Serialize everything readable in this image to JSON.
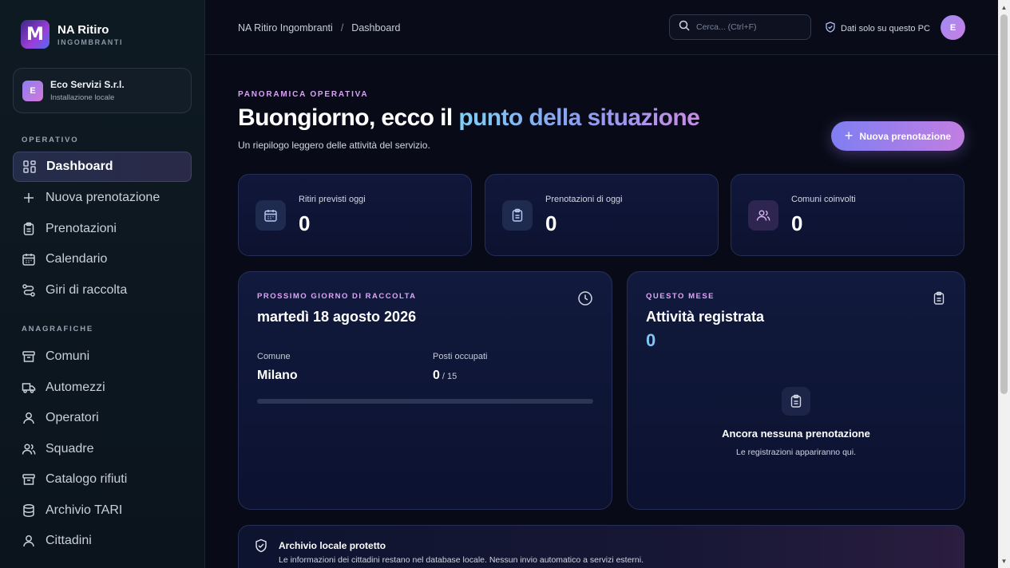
{
  "brand": {
    "name": "NA Ritiro",
    "subtitle": "INGOMBRANTI"
  },
  "org": {
    "avatar": "E",
    "name": "Eco Servizi S.r.l.",
    "subtitle": "Installazione locale"
  },
  "sidebar": {
    "section_operativo": "OPERATIVO",
    "section_anagrafiche": "ANAGRAFICHE",
    "operativo": [
      {
        "label": "Dashboard",
        "icon": "dashboard-icon",
        "active": true
      },
      {
        "label": "Nuova prenotazione",
        "icon": "plus-icon"
      },
      {
        "label": "Prenotazioni",
        "icon": "clipboard-icon"
      },
      {
        "label": "Calendario",
        "icon": "calendar-icon"
      },
      {
        "label": "Giri di raccolta",
        "icon": "route-icon"
      }
    ],
    "anagrafiche": [
      {
        "label": "Comuni",
        "icon": "archive-icon"
      },
      {
        "label": "Automezzi",
        "icon": "truck-icon"
      },
      {
        "label": "Operatori",
        "icon": "user-icon"
      },
      {
        "label": "Squadre",
        "icon": "users-icon"
      },
      {
        "label": "Catalogo rifiuti",
        "icon": "archive-icon"
      },
      {
        "label": "Archivio TARI",
        "icon": "database-icon"
      },
      {
        "label": "Cittadini",
        "icon": "user-icon"
      }
    ]
  },
  "header": {
    "breadcrumb": [
      "NA Ritiro Ingombranti",
      "Dashboard"
    ],
    "breadcrumb_sep": "/",
    "search_placeholder": "Cerca... (Ctrl+F)",
    "privacy_label": "Dati solo su questo PC",
    "user_avatar": "E"
  },
  "hero": {
    "eyebrow": "PANORAMICA OPERATIVA",
    "title_plain": "Buongiorno, ecco il ",
    "title_highlight": "punto della situazione",
    "subtitle": "Un riepilogo leggero delle attività del servizio.",
    "new_booking_label": "Nuova prenotazione"
  },
  "stats": [
    {
      "label": "Ritiri previsti oggi",
      "value": "0",
      "icon": "calendar-icon"
    },
    {
      "label": "Prenotazioni di oggi",
      "value": "0",
      "icon": "clipboard-icon"
    },
    {
      "label": "Comuni coinvolti",
      "value": "0",
      "icon": "users-icon"
    }
  ],
  "next_day": {
    "eyebrow": "PROSSIMO GIORNO DI RACCOLTA",
    "date": "martedì 18 agosto 2026",
    "comune_label": "Comune",
    "comune_value": "Milano",
    "posti_label": "Posti occupati",
    "posti_value": "0",
    "posti_total": "/ 15",
    "progress_fraction": 0
  },
  "month": {
    "eyebrow": "QUESTO MESE",
    "title": "Attività registrata",
    "value": "0",
    "empty_title": "Ancora nessuna prenotazione",
    "empty_subtitle": "Le registrazioni appariranno qui."
  },
  "notice": {
    "title": "Archivio locale protetto",
    "text": "Le informazioni dei cittadini restano nel database locale. Nessun invio automatico a servizi esterni."
  },
  "colors": {
    "accent_start": "#7f7ef2",
    "accent_end": "#c27ee2",
    "highlight_blue": "#7ec6f3"
  }
}
